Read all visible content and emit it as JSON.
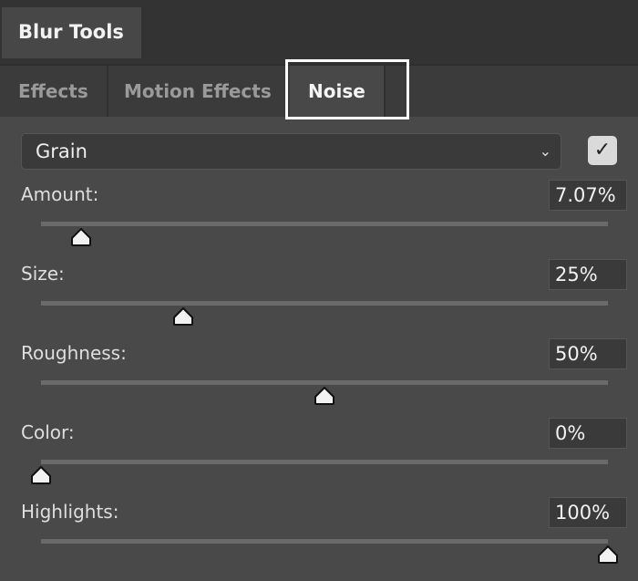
{
  "panel": {
    "title": "Blur Tools"
  },
  "tabs": [
    {
      "label": "Effects",
      "active": false
    },
    {
      "label": "Motion Effects",
      "active": false
    },
    {
      "label": "Noise",
      "active": true
    }
  ],
  "dropdown": {
    "value": "Grain",
    "icon": "chevron-down-icon"
  },
  "enabled_checkbox": {
    "checked": true,
    "icon": "checkmark-icon"
  },
  "sliders": [
    {
      "label": "Amount:",
      "value": "7.07%",
      "position": 7.07
    },
    {
      "label": "Size:",
      "value": "25%",
      "position": 25
    },
    {
      "label": "Roughness:",
      "value": "50%",
      "position": 50
    },
    {
      "label": "Color:",
      "value": "0%",
      "position": 0
    },
    {
      "label": "Highlights:",
      "value": "100%",
      "position": 100
    }
  ],
  "colors": {
    "background": "#494949",
    "highlight_box": "#ffffff"
  }
}
